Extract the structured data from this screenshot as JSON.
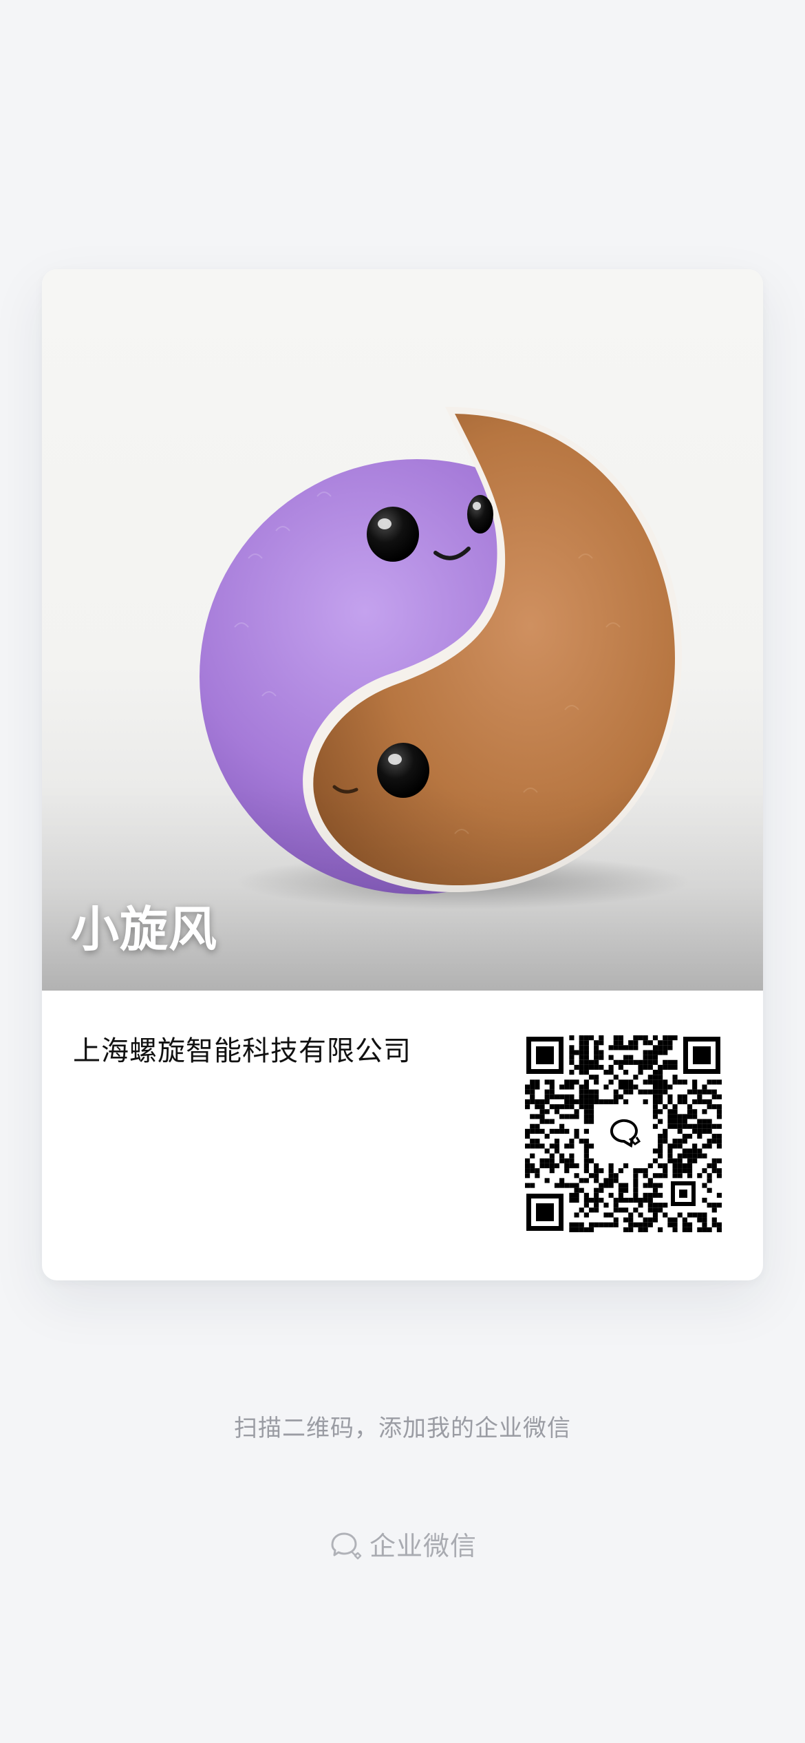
{
  "profile": {
    "nickname": "小旋风",
    "company": "上海螺旋智能科技有限公司"
  },
  "hint": {
    "text": "扫描二维码，添加我的企业微信"
  },
  "brand": {
    "icon": "wecom-icon",
    "label": "企业微信"
  },
  "colors": {
    "background": "#f4f5f7",
    "card": "#ffffff",
    "text_primary": "#111111",
    "text_secondary": "#9a9ca3",
    "purple_fur": "#a37ad6",
    "brown_fur": "#b97a45"
  }
}
